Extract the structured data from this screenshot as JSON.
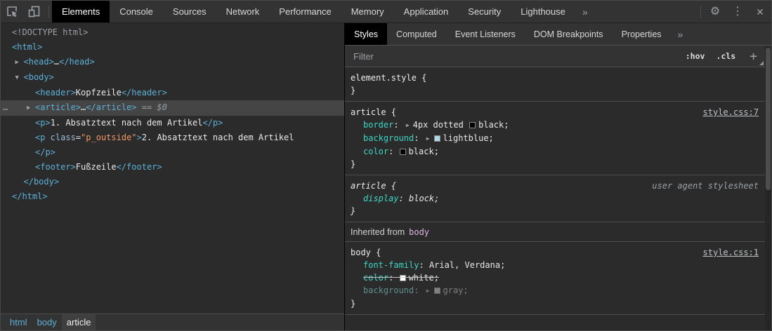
{
  "glyphs": {
    "collapsed": "▶",
    "expanded": "▼",
    "gear": "⚙",
    "kebab": "⋮",
    "close": "✕"
  },
  "colors": {
    "tag_blue": "#5db0d7",
    "attr_value_orange": "#f29766",
    "css_property_teal": "#3dd6c5",
    "node_link_pink": "#dfb6e3",
    "selected_row": "#454545",
    "active_tab_bg": "#000000",
    "swatch_black": "#000000",
    "swatch_lightblue": "#add8e6",
    "swatch_white": "#ffffff",
    "swatch_gray": "#808080"
  },
  "toolbar": {
    "more_tabs": "»",
    "tabs": [
      {
        "id": "elements",
        "label": "Elements",
        "active": true
      },
      {
        "id": "console",
        "label": "Console"
      },
      {
        "id": "sources",
        "label": "Sources"
      },
      {
        "id": "network",
        "label": "Network"
      },
      {
        "id": "performance",
        "label": "Performance"
      },
      {
        "id": "memory",
        "label": "Memory"
      },
      {
        "id": "application",
        "label": "Application"
      },
      {
        "id": "security",
        "label": "Security"
      },
      {
        "id": "lighthouse",
        "label": "Lighthouse"
      }
    ]
  },
  "dom_tree": {
    "rows": [
      {
        "indent": 0,
        "tokens": [
          [
            "gray",
            "<!DOCTYPE html>"
          ]
        ]
      },
      {
        "indent": 0,
        "tokens": [
          [
            "tag",
            "<html>"
          ]
        ]
      },
      {
        "indent": 1,
        "arrow": "collapsed",
        "tokens": [
          [
            "tag",
            "<head>"
          ],
          [
            "txt",
            "…"
          ],
          [
            "tag",
            "</head>"
          ]
        ]
      },
      {
        "indent": 1,
        "arrow": "expanded",
        "tokens": [
          [
            "tag",
            "<body>"
          ]
        ]
      },
      {
        "indent": 2,
        "tokens": [
          [
            "tag",
            "<header>"
          ],
          [
            "txt",
            "Kopfzeile"
          ],
          [
            "tag",
            "</header>"
          ]
        ]
      },
      {
        "indent": 2,
        "selected": true,
        "gutter": "…",
        "arrow": "collapsed",
        "tokens": [
          [
            "tag",
            "<article>"
          ],
          [
            "txt",
            "…"
          ],
          [
            "tag",
            "</article>"
          ],
          [
            "eq",
            " == $0"
          ]
        ]
      },
      {
        "indent": 2,
        "tokens": [
          [
            "tag",
            "<p>"
          ],
          [
            "txt",
            "1. Absatztext nach dem Artikel"
          ],
          [
            "tag",
            "</p>"
          ]
        ]
      },
      {
        "indent": 2,
        "tokens": [
          [
            "tag",
            "<p"
          ],
          [
            "attr",
            " class"
          ],
          [
            "punct",
            "="
          ],
          [
            "val",
            "\"p_outside\""
          ],
          [
            "tag",
            ">"
          ],
          [
            "txt",
            "2. Absatztext nach dem Artikel"
          ]
        ]
      },
      {
        "indent": 2,
        "tokens": [
          [
            "tag",
            "</p>"
          ]
        ]
      },
      {
        "indent": 2,
        "tokens": [
          [
            "tag",
            "<footer>"
          ],
          [
            "txt",
            "Fußzeile"
          ],
          [
            "tag",
            "</footer>"
          ]
        ]
      },
      {
        "indent": 1,
        "tokens": [
          [
            "tag",
            "</body>"
          ]
        ]
      },
      {
        "indent": 0,
        "tokens": [
          [
            "tag",
            "</html>"
          ]
        ]
      }
    ],
    "breadcrumbs": [
      {
        "label": "html"
      },
      {
        "label": "body"
      },
      {
        "label": "article",
        "active": true
      }
    ]
  },
  "styles_panel": {
    "more_tabs": "»",
    "filter_placeholder": "Filter",
    "pseudo_toggle": ":hov",
    "class_toggle": ".cls",
    "new_rule": "+",
    "tabs": [
      {
        "id": "styles",
        "label": "Styles",
        "active": true
      },
      {
        "id": "computed",
        "label": "Computed"
      },
      {
        "id": "event-listeners",
        "label": "Event Listeners"
      },
      {
        "id": "dom-breakpoints",
        "label": "DOM Breakpoints"
      },
      {
        "id": "properties",
        "label": "Properties"
      }
    ],
    "sections": [
      {
        "kind": "rule",
        "selector": "element.style {",
        "close": "}",
        "props": []
      },
      {
        "kind": "rule",
        "selector": "article {",
        "link": "style.css:7",
        "close": "}",
        "props": [
          {
            "parts": [
              [
                "name",
                "border"
              ],
              [
                "plain",
                ": "
              ],
              [
                "arrow",
                ""
              ],
              [
                "plain",
                "4px dotted "
              ],
              [
                "swatch",
                "#000000"
              ],
              [
                "plain",
                "black;"
              ]
            ]
          },
          {
            "parts": [
              [
                "name",
                "background"
              ],
              [
                "plain",
                ": "
              ],
              [
                "arrow",
                ""
              ],
              [
                "swatch",
                "#add8e6"
              ],
              [
                "plain",
                "lightblue;"
              ]
            ]
          },
          {
            "parts": [
              [
                "name",
                "color"
              ],
              [
                "plain",
                ": "
              ],
              [
                "swatch",
                "#000000"
              ],
              [
                "plain",
                "black;"
              ]
            ]
          }
        ]
      },
      {
        "kind": "rule",
        "italic": true,
        "selector": "article {",
        "note": "user agent stylesheet",
        "close": "}",
        "props": [
          {
            "parts": [
              [
                "name",
                "display"
              ],
              [
                "plain",
                ": "
              ],
              [
                "plain",
                "block;"
              ]
            ]
          }
        ]
      },
      {
        "kind": "header",
        "text": "Inherited from",
        "node": "body"
      },
      {
        "kind": "rule",
        "selector": "body {",
        "link": "style.css:1",
        "close": "}",
        "props": [
          {
            "parts": [
              [
                "name",
                "font-family"
              ],
              [
                "plain",
                ": "
              ],
              [
                "plain",
                "Arial, Verdana;"
              ]
            ]
          },
          {
            "state": "struck",
            "parts": [
              [
                "name",
                "color"
              ],
              [
                "plain",
                ": "
              ],
              [
                "swatch",
                "#ffffff"
              ],
              [
                "plain",
                "white;"
              ]
            ]
          },
          {
            "state": "dimmed",
            "parts": [
              [
                "name",
                "background"
              ],
              [
                "plain",
                ": "
              ],
              [
                "arrow",
                ""
              ],
              [
                "swatch",
                "#808080"
              ],
              [
                "plain",
                "gray;"
              ]
            ]
          }
        ]
      }
    ]
  }
}
